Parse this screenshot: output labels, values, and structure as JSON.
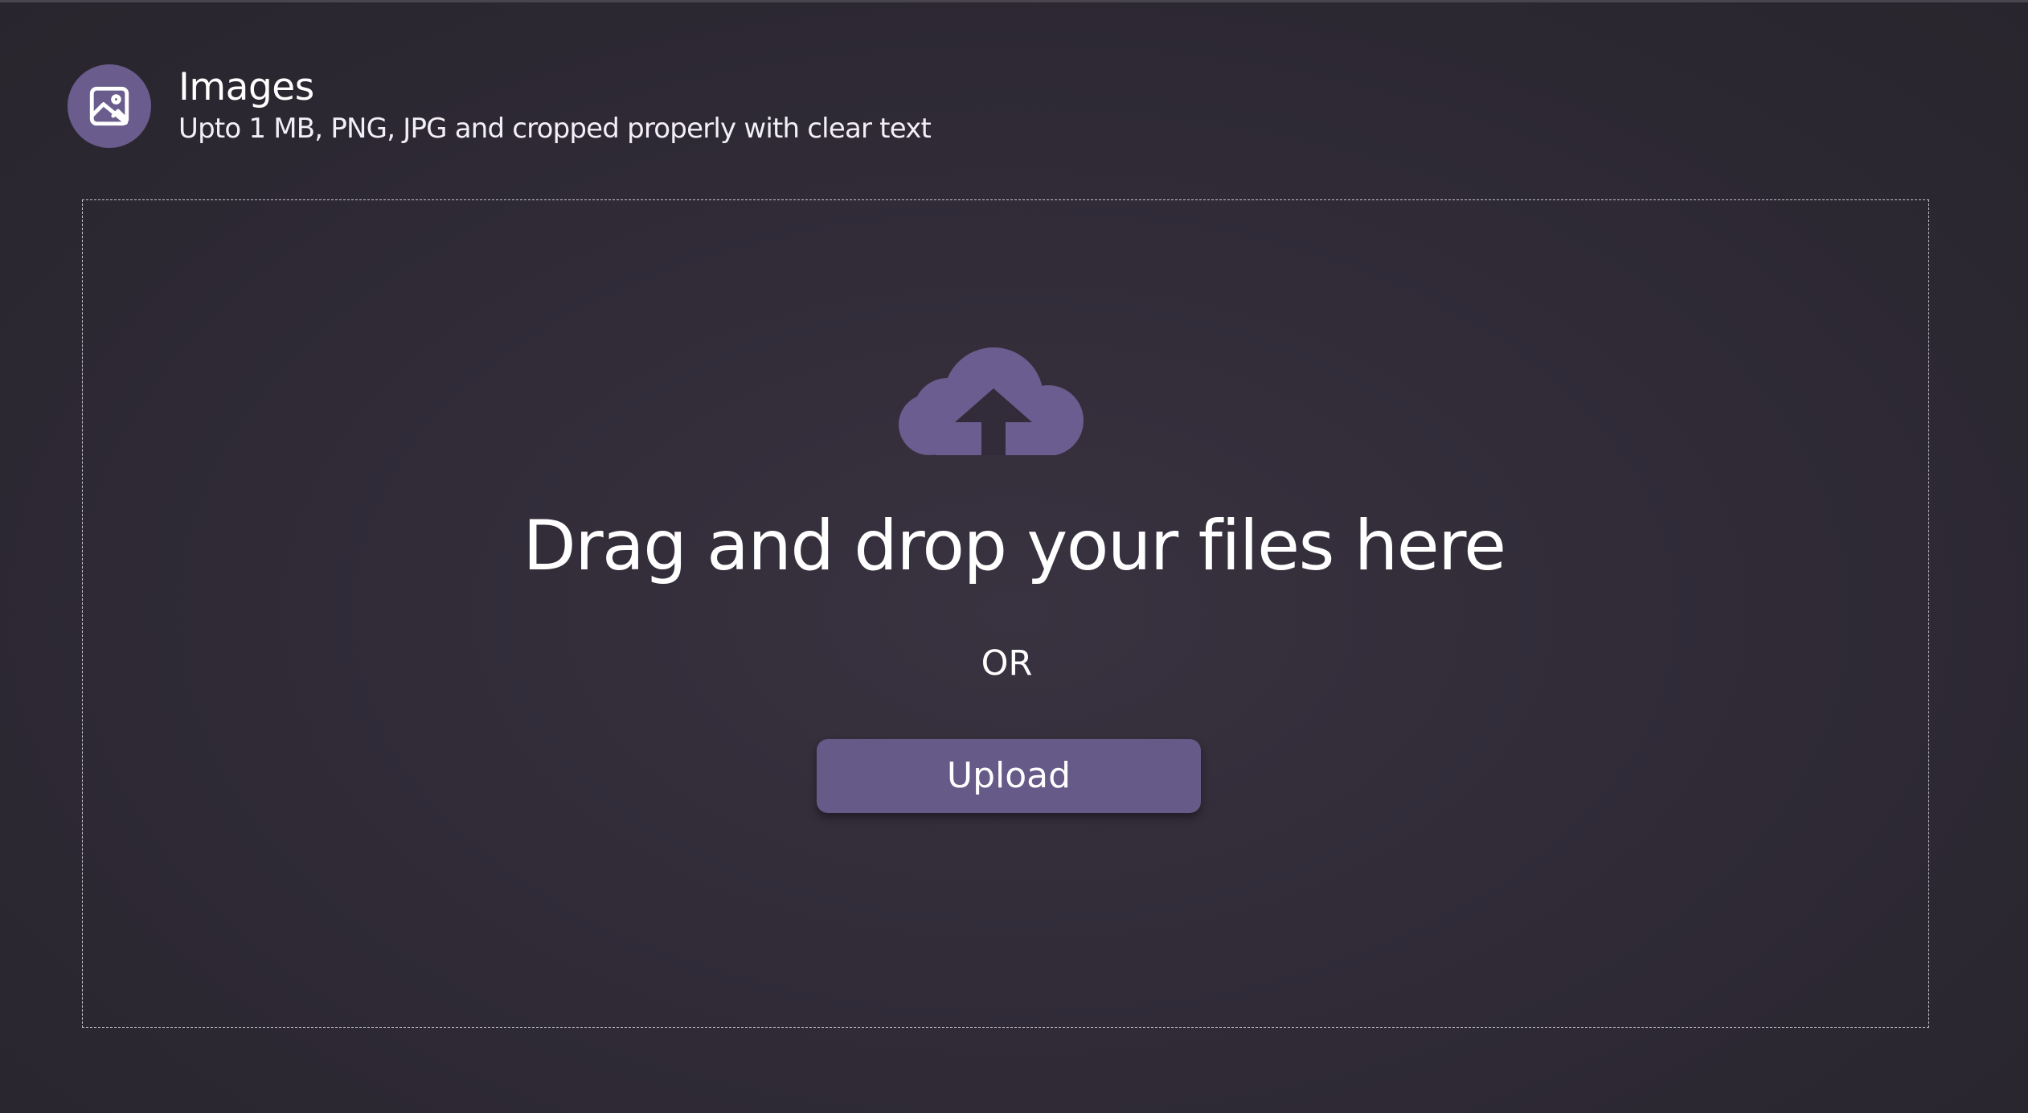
{
  "header": {
    "icon": "image-icon",
    "title": "Images",
    "subtitle": "Upto 1 MB, PNG, JPG and cropped properly with clear text"
  },
  "dropzone": {
    "icon": "cloud-upload-icon",
    "headline": "Drag and drop your files here",
    "separator": "OR",
    "upload_label": "Upload"
  },
  "colors": {
    "accent": "#665a88",
    "avatar": "#6a5c8c",
    "background": "#2f2a36",
    "text": "#ffffff"
  }
}
